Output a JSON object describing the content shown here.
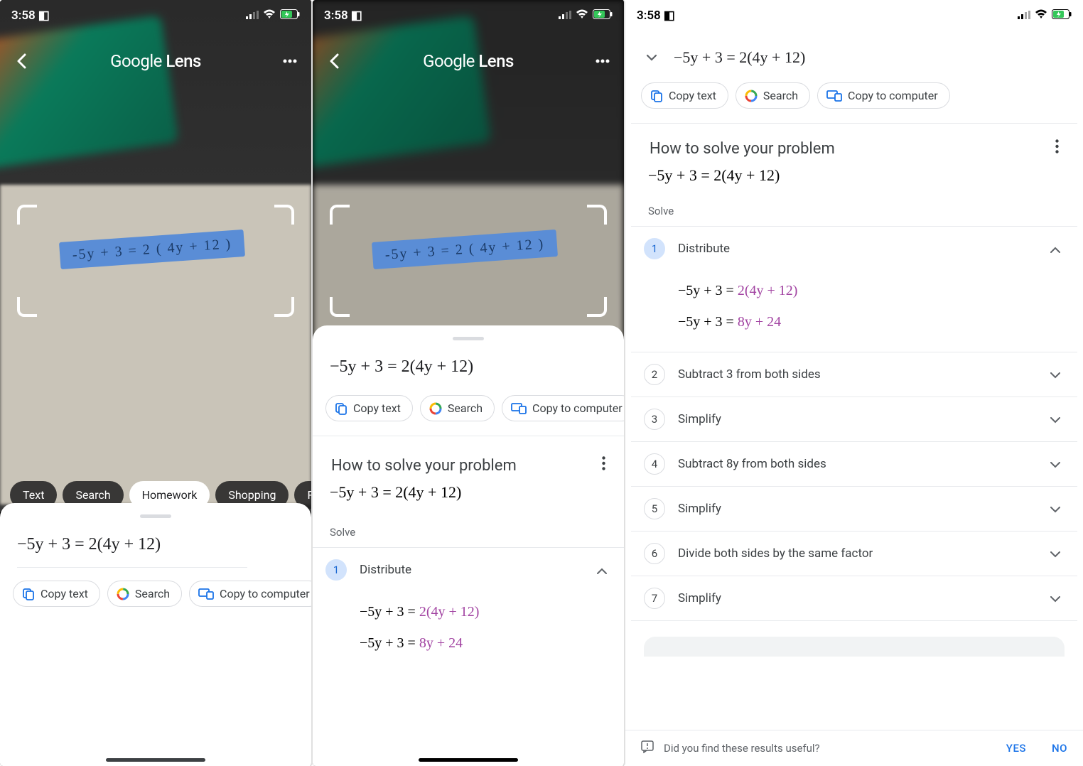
{
  "status": {
    "time": "3:58",
    "signal": "▪",
    "wifi": "◉",
    "battery": "⚡"
  },
  "lens": {
    "title_prefix": "Google",
    "title_suffix": "Lens"
  },
  "handwritten_equation": "-5y + 3 = 2 ( 4y + 12 )",
  "modes": [
    "Text",
    "Search",
    "Homework",
    "Shopping",
    "Places"
  ],
  "equation": "−5y + 3 = 2(4y + 12)",
  "chips": {
    "copy_text": "Copy text",
    "search": "Search",
    "copy_computer": "Copy to computer"
  },
  "solve": {
    "header": "How to solve your problem",
    "equation": "−5y + 3 = 2(4y + 12)",
    "sub": "Solve"
  },
  "steps": [
    {
      "n": "1",
      "label": "Distribute",
      "expanded": true,
      "lines": [
        {
          "pre": "−5y + 3 = ",
          "hl": "2(4y + 12)"
        },
        {
          "pre": "−5y + 3 = ",
          "hl": "8y + 24"
        }
      ]
    },
    {
      "n": "2",
      "label": "Subtract 3 from both sides"
    },
    {
      "n": "3",
      "label": "Simplify"
    },
    {
      "n": "4",
      "label": "Subtract 8y from both sides"
    },
    {
      "n": "5",
      "label": "Simplify"
    },
    {
      "n": "6",
      "label": "Divide both sides by the same factor"
    },
    {
      "n": "7",
      "label": "Simplify"
    }
  ],
  "feedback": {
    "prompt": "Did you find these results useful?",
    "yes": "YES",
    "no": "NO"
  }
}
